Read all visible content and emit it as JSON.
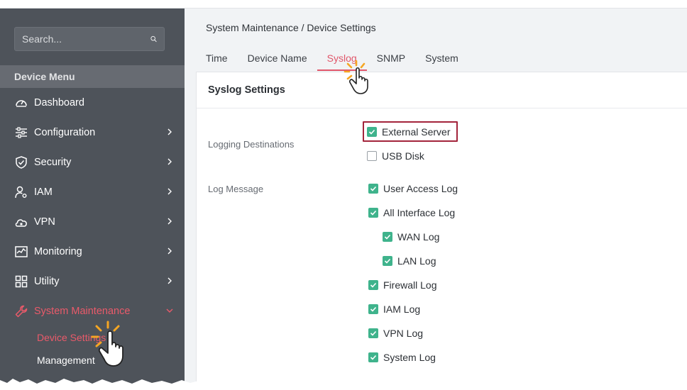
{
  "sidebar": {
    "search_placeholder": "Search...",
    "menu_header": "Device Menu",
    "items": [
      {
        "label": "Dashboard",
        "icon": "gauge-icon",
        "chevron": false
      },
      {
        "label": "Configuration",
        "icon": "sliders-icon",
        "chevron": true
      },
      {
        "label": "Security",
        "icon": "shield-icon",
        "chevron": true
      },
      {
        "label": "IAM",
        "icon": "user-gear-icon",
        "chevron": true
      },
      {
        "label": "VPN",
        "icon": "cloud-lock-icon",
        "chevron": true
      },
      {
        "label": "Monitoring",
        "icon": "chart-icon",
        "chevron": true
      },
      {
        "label": "Utility",
        "icon": "grid-icon",
        "chevron": true
      },
      {
        "label": "System Maintenance",
        "icon": "wrench-icon",
        "chevron": true,
        "expanded": true
      }
    ],
    "subitems": [
      {
        "label": "Device Settings",
        "active": true
      },
      {
        "label": "Management",
        "active": false
      }
    ]
  },
  "main": {
    "breadcrumb": "System Maintenance / Device Settings",
    "tabs": [
      {
        "label": "Time"
      },
      {
        "label": "Device Name"
      },
      {
        "label": "Syslog",
        "active": true
      },
      {
        "label": "SNMP"
      },
      {
        "label": "System"
      }
    ],
    "panel": {
      "title": "Syslog Settings",
      "logging_destinations_label": "Logging Destinations",
      "destinations": [
        {
          "label": "External Server",
          "checked": true
        },
        {
          "label": "USB Disk",
          "checked": false
        }
      ],
      "log_message_label": "Log Message",
      "log_messages": [
        {
          "label": "User Access Log",
          "checked": true,
          "indent": 0
        },
        {
          "label": "All Interface Log",
          "checked": true,
          "indent": 0
        },
        {
          "label": "WAN Log",
          "checked": true,
          "indent": 1
        },
        {
          "label": "LAN Log",
          "checked": true,
          "indent": 1
        },
        {
          "label": "Firewall Log",
          "checked": true,
          "indent": 0
        },
        {
          "label": "IAM Log",
          "checked": true,
          "indent": 0
        },
        {
          "label": "VPN Log",
          "checked": true,
          "indent": 0
        },
        {
          "label": "System Log",
          "checked": true,
          "indent": 0
        }
      ]
    }
  },
  "colors": {
    "sidebar_bg": "#4e535a",
    "accent": "#e0566a",
    "checkbox": "#3fb38c",
    "highlight_border": "#a3243b"
  }
}
